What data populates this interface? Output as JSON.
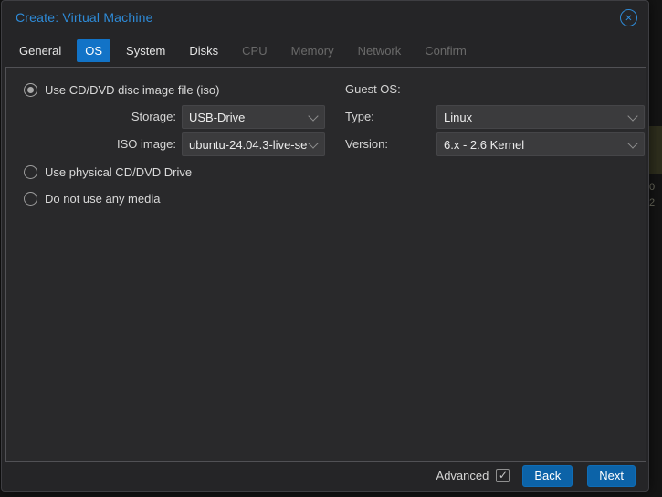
{
  "window": {
    "title": "Create: Virtual Machine",
    "close_icon": "circled-x"
  },
  "tabs": [
    {
      "label": "General",
      "state": "normal"
    },
    {
      "label": "OS",
      "state": "active"
    },
    {
      "label": "System",
      "state": "normal"
    },
    {
      "label": "Disks",
      "state": "normal"
    },
    {
      "label": "CPU",
      "state": "disabled"
    },
    {
      "label": "Memory",
      "state": "disabled"
    },
    {
      "label": "Network",
      "state": "disabled"
    },
    {
      "label": "Confirm",
      "state": "disabled"
    }
  ],
  "form": {
    "left": {
      "radios": [
        {
          "label": "Use CD/DVD disc image file (iso)",
          "selected": true
        },
        {
          "label": "Use physical CD/DVD Drive",
          "selected": false
        },
        {
          "label": "Do not use any media",
          "selected": false
        }
      ],
      "fields": [
        {
          "label": "Storage:",
          "value": "USB-Drive"
        },
        {
          "label": "ISO image:",
          "value": "ubuntu-24.04.3-live-se"
        }
      ]
    },
    "right": {
      "heading": "Guest OS:",
      "fields": [
        {
          "label": "Type:",
          "value": "Linux"
        },
        {
          "label": "Version:",
          "value": "6.x - 2.6 Kernel"
        }
      ]
    }
  },
  "footer": {
    "advanced_label": "Advanced",
    "advanced_checked": true,
    "check_glyph": "✓",
    "back_label": "Back",
    "next_label": "Next"
  },
  "background": {
    "partial_chars": [
      "0",
      "2"
    ]
  },
  "colors": {
    "title_blue": "#2e8bd8",
    "tab_active_bg": "#1273c7",
    "button_bg": "#0c63a8",
    "dialog_bg": "#252527",
    "panel_bg": "#29292b",
    "field_bg": "#3b3b3d",
    "disabled_text": "#6a6a6a"
  },
  "glyphs": {
    "close": "✕"
  }
}
